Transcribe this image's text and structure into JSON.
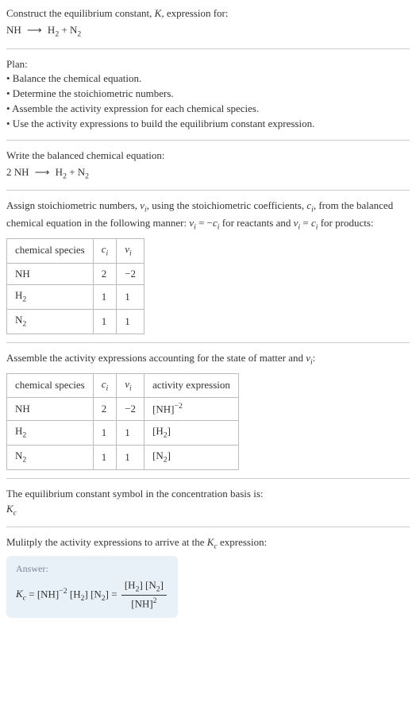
{
  "header": {
    "title_line1": "Construct the equilibrium constant, K, expression for:",
    "equation": "NH ⟶ H₂ + N₂"
  },
  "plan": {
    "title": "Plan:",
    "items": [
      "• Balance the chemical equation.",
      "• Determine the stoichiometric numbers.",
      "• Assemble the activity expression for each chemical species.",
      "• Use the activity expressions to build the equilibrium constant expression."
    ]
  },
  "balanced": {
    "title": "Write the balanced chemical equation:",
    "equation": "2 NH ⟶ H₂ + N₂"
  },
  "stoich": {
    "intro_part1": "Assign stoichiometric numbers, ",
    "intro_part2": ", using the stoichiometric coefficients, ",
    "intro_part3": ", from the balanced chemical equation in the following manner: ",
    "intro_part4": " for reactants and ",
    "intro_part5": " for products:",
    "nu_i": "νᵢ",
    "c_i": "cᵢ",
    "eq_reactants": "νᵢ = −cᵢ",
    "eq_products": "νᵢ = cᵢ",
    "table": {
      "headers": [
        "chemical species",
        "cᵢ",
        "νᵢ"
      ],
      "rows": [
        [
          "NH",
          "2",
          "−2"
        ],
        [
          "H₂",
          "1",
          "1"
        ],
        [
          "N₂",
          "1",
          "1"
        ]
      ]
    }
  },
  "activity": {
    "intro_part1": "Assemble the activity expressions accounting for the state of matter and ",
    "intro_part2": ":",
    "nu_i": "νᵢ",
    "table": {
      "headers": [
        "chemical species",
        "cᵢ",
        "νᵢ",
        "activity expression"
      ],
      "rows": [
        {
          "species": "NH",
          "ci": "2",
          "vi": "−2",
          "expr": "[NH]⁻²"
        },
        {
          "species": "H₂",
          "ci": "1",
          "vi": "1",
          "expr": "[H₂]"
        },
        {
          "species": "N₂",
          "ci": "1",
          "vi": "1",
          "expr": "[N₂]"
        }
      ]
    }
  },
  "symbol": {
    "title": "The equilibrium constant symbol in the concentration basis is:",
    "value": "K",
    "sub": "c"
  },
  "multiply": {
    "title_part1": "Mulitply the activity expressions to arrive at the ",
    "title_part2": " expression:",
    "kc": "K",
    "kc_sub": "c"
  },
  "answer": {
    "label": "Answer:",
    "lhs_k": "K",
    "lhs_sub": "c",
    "term1_base": "[NH]",
    "term1_exp": "−2",
    "term2": "[H₂]",
    "term3": "[N₂]",
    "frac_num": "[H₂] [N₂]",
    "frac_den_base": "[NH]",
    "frac_den_exp": "2"
  },
  "chart_data": {
    "type": "table",
    "tables": [
      {
        "title": "Stoichiometric numbers",
        "columns": [
          "chemical species",
          "cᵢ",
          "νᵢ"
        ],
        "rows": [
          {
            "chemical species": "NH",
            "cᵢ": 2,
            "νᵢ": -2
          },
          {
            "chemical species": "H₂",
            "cᵢ": 1,
            "νᵢ": 1
          },
          {
            "chemical species": "N₂",
            "cᵢ": 1,
            "νᵢ": 1
          }
        ]
      },
      {
        "title": "Activity expressions",
        "columns": [
          "chemical species",
          "cᵢ",
          "νᵢ",
          "activity expression"
        ],
        "rows": [
          {
            "chemical species": "NH",
            "cᵢ": 2,
            "νᵢ": -2,
            "activity expression": "[NH]^-2"
          },
          {
            "chemical species": "H₂",
            "cᵢ": 1,
            "νᵢ": 1,
            "activity expression": "[H₂]"
          },
          {
            "chemical species": "N₂",
            "cᵢ": 1,
            "νᵢ": 1,
            "activity expression": "[N₂]"
          }
        ]
      }
    ]
  }
}
